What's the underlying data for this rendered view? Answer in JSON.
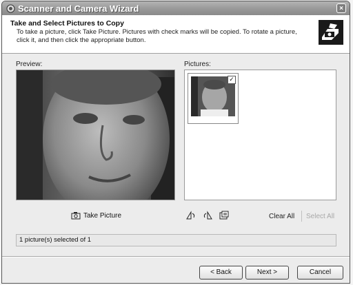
{
  "window": {
    "title": "Scanner and Camera Wizard",
    "close_glyph": "×"
  },
  "header": {
    "title": "Take and Select Pictures to Copy",
    "description": "To take a picture, click Take Picture. Pictures with check marks will be copied. To rotate a picture, click it, and then click the appropriate button."
  },
  "preview": {
    "label": "Preview:"
  },
  "pictures": {
    "label": "Pictures:",
    "items": [
      {
        "checked": true,
        "check_glyph": "✓"
      }
    ]
  },
  "toolbar": {
    "take_picture_label": "Take Picture",
    "rotate_icons": [
      "rotate-left-icon",
      "rotate-right-icon",
      "properties-icon"
    ],
    "clear_all_label": "Clear All",
    "select_all_label": "Select All"
  },
  "status": {
    "text": "1 picture(s) selected of 1"
  },
  "buttons": {
    "back": "< Back",
    "next": "Next >",
    "cancel": "Cancel"
  }
}
